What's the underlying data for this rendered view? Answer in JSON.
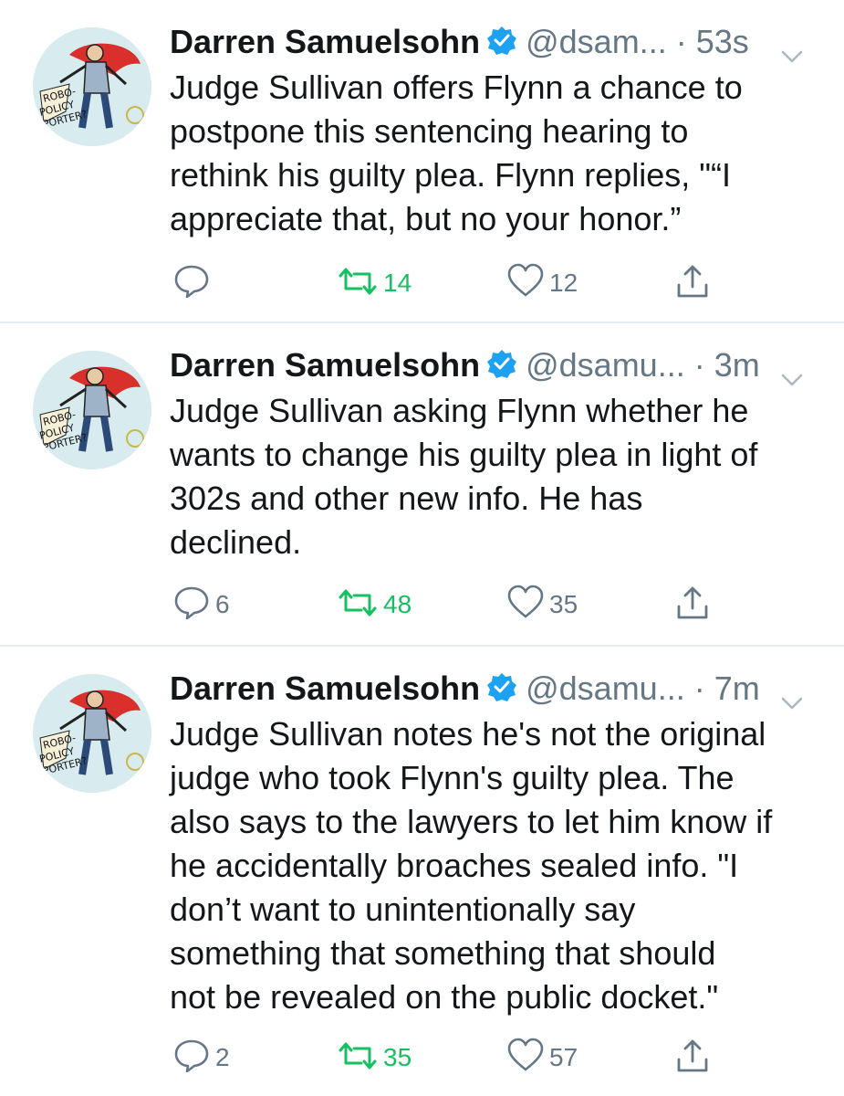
{
  "tweets": [
    {
      "author": "Darren Samuelsohn",
      "handle": "@dsam...",
      "time": "· 53s",
      "text": "Judge Sullivan offers Flynn a chance to\npostpone this sentencing hearing to\nrethink his guilty plea. Flynn replies, \"“I\nappreciate that, but no your honor.”",
      "replies": "",
      "retweets": "14",
      "likes": "12"
    },
    {
      "author": "Darren Samuelsohn",
      "handle": "@dsamu...",
      "time": "· 3m",
      "text": "Judge Sullivan asking Flynn whether he\nwants to change his guilty plea in light of\n302s and other new info. He has\ndeclined.",
      "replies": "6",
      "retweets": "48",
      "likes": "35"
    },
    {
      "author": "Darren Samuelsohn",
      "handle": "@dsamu...",
      "time": "· 7m",
      "text": "Judge Sullivan notes he's not the original\njudge who took Flynn's guilty plea. The\nalso says to the lawyers to let him know if\nhe accidentally broaches sealed info. \"I\ndon’t want to unintentionally say\nsomething that something that should\nnot be revealed on the public docket.\"",
      "replies": "2",
      "retweets": "35",
      "likes": "57"
    }
  ],
  "avatar_caption": "ROBO-POLICY PORTER?",
  "colors": {
    "text": "#14171a",
    "secondary": "#657786",
    "retweet_green": "#17bf63",
    "verified_blue": "#1da1f2",
    "divider": "#e6ecf0"
  },
  "icons": [
    "reply-icon",
    "retweet-icon",
    "like-icon",
    "share-icon",
    "verified-badge-icon",
    "chevron-down-icon"
  ]
}
